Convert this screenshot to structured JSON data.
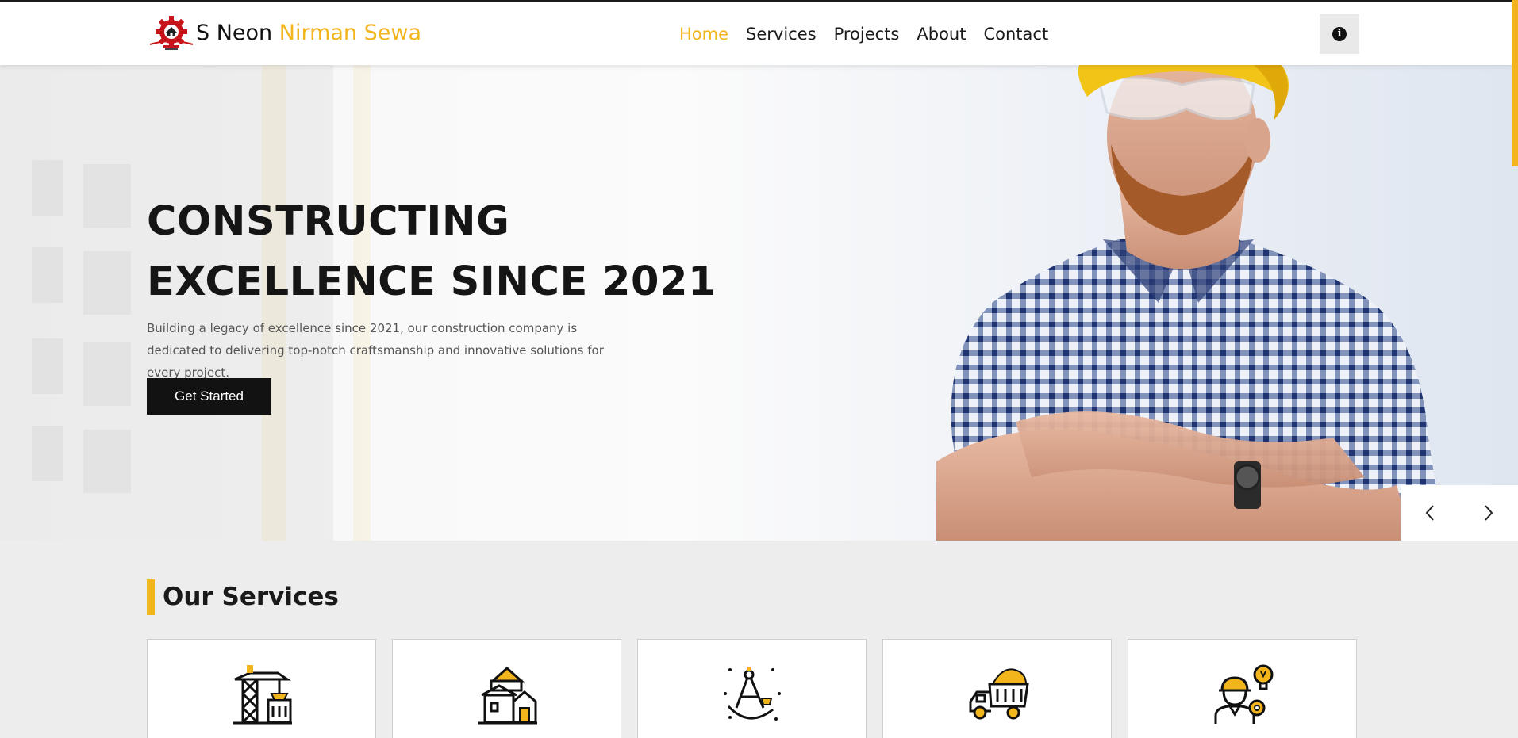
{
  "header": {
    "brand_part1": "S Neon",
    "brand_part2": "Nirman Sewa",
    "logo_icon": "gear-house-logo",
    "nav": [
      {
        "label": "Home",
        "active": true
      },
      {
        "label": "Services",
        "active": false
      },
      {
        "label": "Projects",
        "active": false
      },
      {
        "label": "About",
        "active": false
      },
      {
        "label": "Contact",
        "active": false
      }
    ],
    "info_icon": "info-icon"
  },
  "hero": {
    "title_line1": "CONSTRUCTING",
    "title_line2": "EXCELLENCE SINCE 2021",
    "description": "Building a legacy of excellence since 2021, our construction company is dedicated to delivering top-notch craftsmanship and innovative solutions for every project.",
    "cta_label": "Get Started",
    "prev_icon": "chevron-left-icon",
    "next_icon": "chevron-right-icon"
  },
  "services": {
    "title": "Our Services",
    "cards": [
      {
        "icon": "crane-tower-icon"
      },
      {
        "icon": "house-building-icon"
      },
      {
        "icon": "compass-drafting-icon"
      },
      {
        "icon": "dump-truck-icon"
      },
      {
        "icon": "engineer-idea-icon"
      }
    ]
  },
  "colors": {
    "accent": "#f2b51c",
    "dark": "#121212",
    "section_bg": "#ededed"
  }
}
